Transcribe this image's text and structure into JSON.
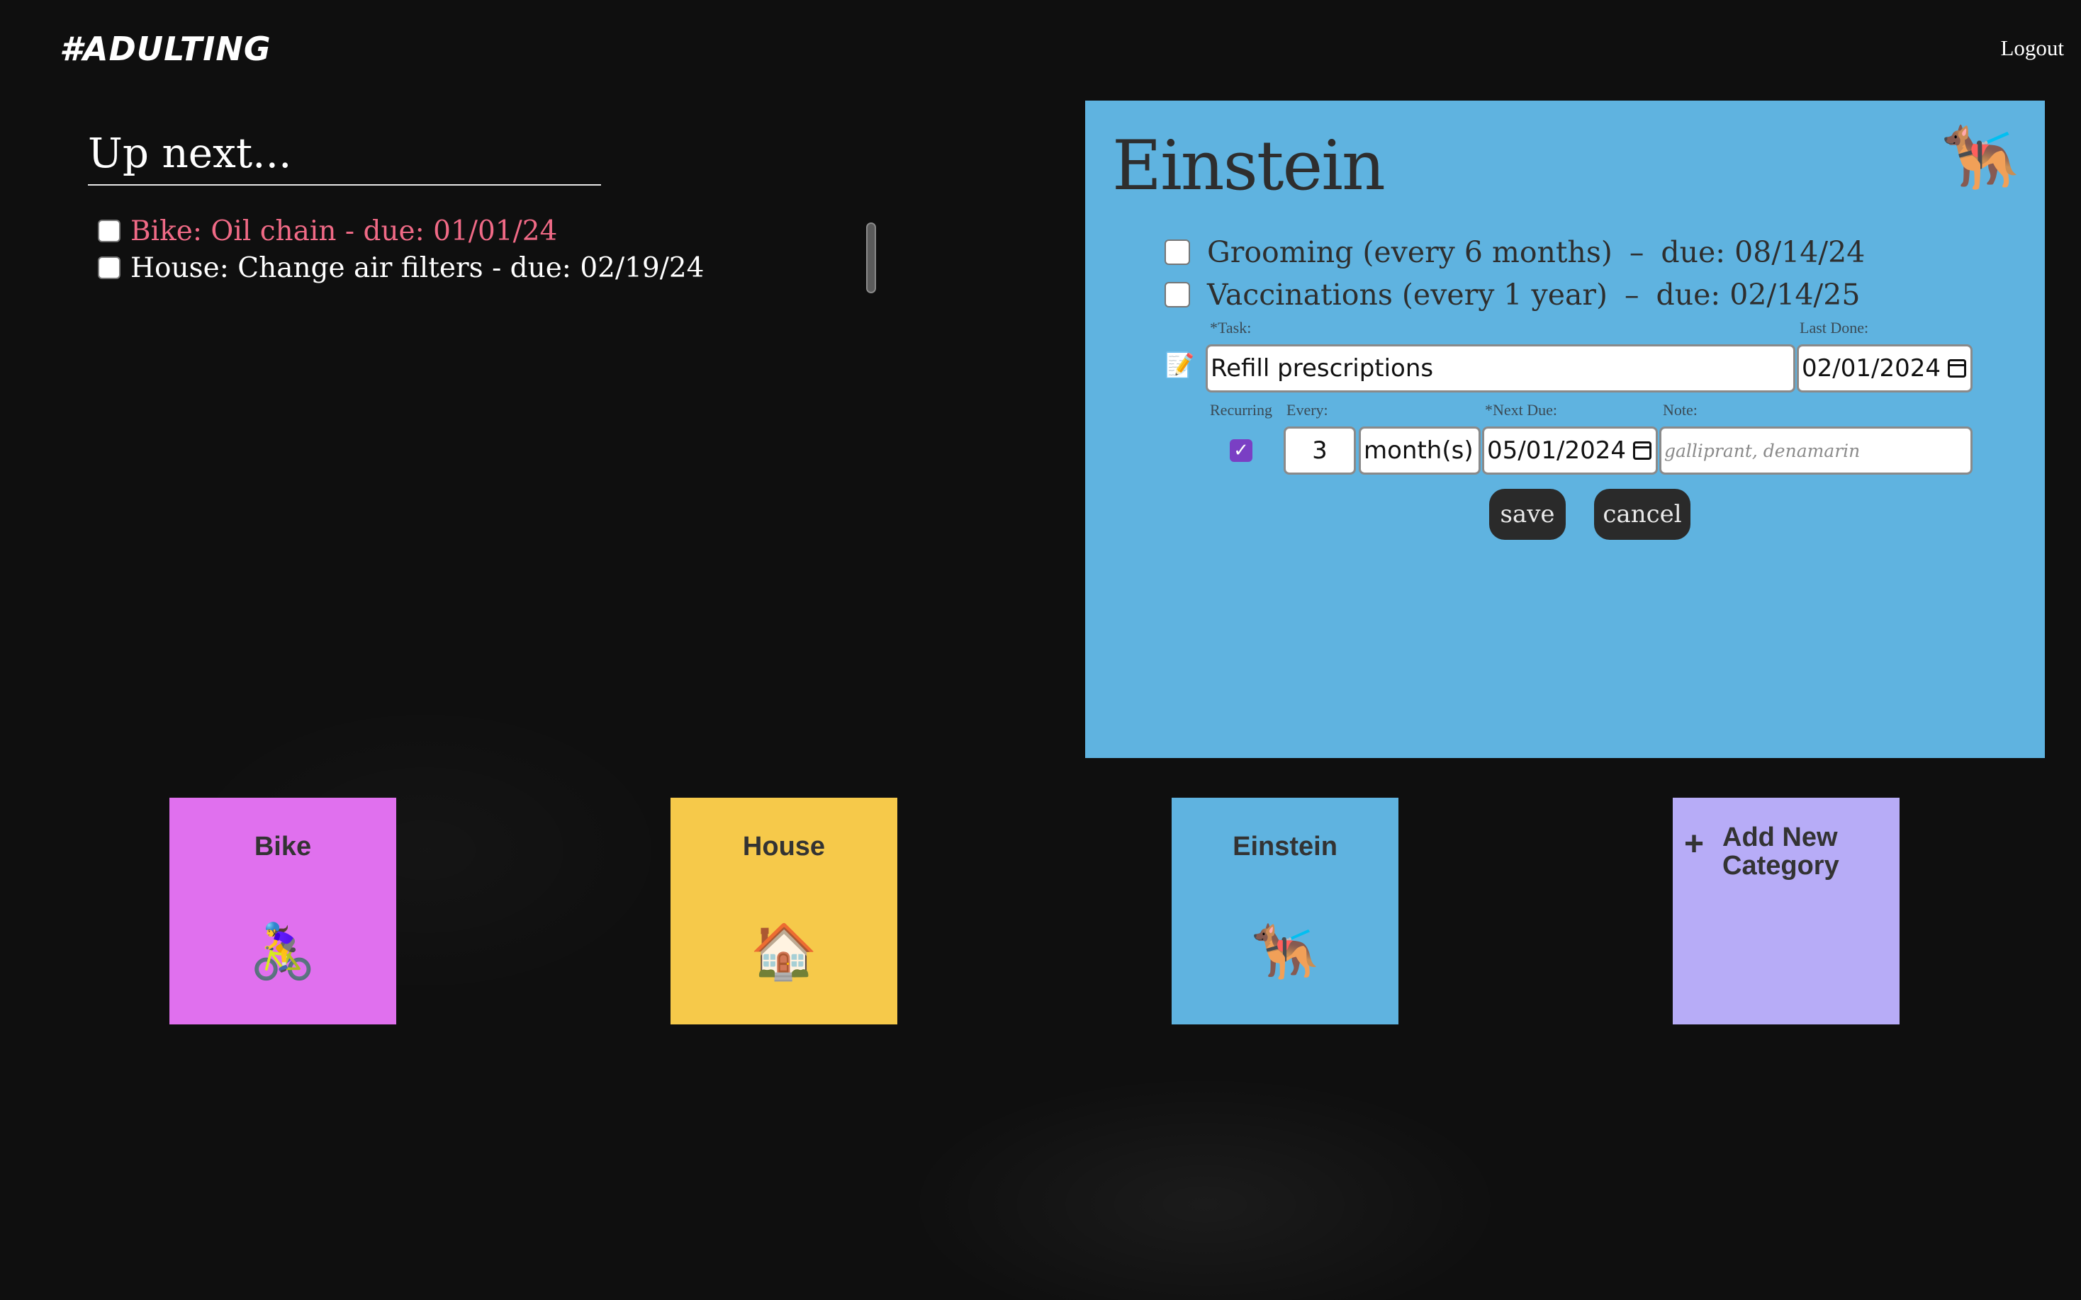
{
  "header": {
    "logo": "#ADULTING",
    "logout": "Logout"
  },
  "up_next": {
    "title": "Up next...",
    "items": [
      {
        "label": "Bike: Oil chain - due: 01/01/24",
        "overdue": true
      },
      {
        "label": "House: Change air filters - due: 02/19/24",
        "overdue": false
      }
    ]
  },
  "panel": {
    "title": "Einstein",
    "icon": "🐕‍🦺",
    "color": "#5fb3e0",
    "tasks": [
      {
        "name": "Grooming (every 6 months)",
        "sep": "–",
        "due": "due: 08/14/24"
      },
      {
        "name": "Vaccinations (every 1 year)",
        "sep": "–",
        "due": "due: 02/14/25"
      }
    ],
    "form": {
      "task_label": "*Task:",
      "task_value": "Refill prescriptions",
      "last_done_label": "Last Done:",
      "last_done_value": "02/01/2024",
      "recurring_label": "Recurring",
      "recurring_checked": true,
      "every_label": "Every:",
      "every_value": "3",
      "unit_value": "month(s)",
      "next_due_label": "*Next Due:",
      "next_due_value": "05/01/2024",
      "note_label": "Note:",
      "note_placeholder": "galliprant, denamarin",
      "save": "save",
      "cancel": "cancel"
    }
  },
  "categories": [
    {
      "label": "Bike",
      "icon": "🚴‍♀️",
      "color": "#e070ee"
    },
    {
      "label": "House",
      "icon": "🏠",
      "color": "#f6c94a"
    },
    {
      "label": "Einstein",
      "icon": "🐕‍🦺",
      "color": "#5fb3e0"
    }
  ],
  "add_category": {
    "plus": "+",
    "label": "Add New Category",
    "color": "#b7acf7"
  }
}
